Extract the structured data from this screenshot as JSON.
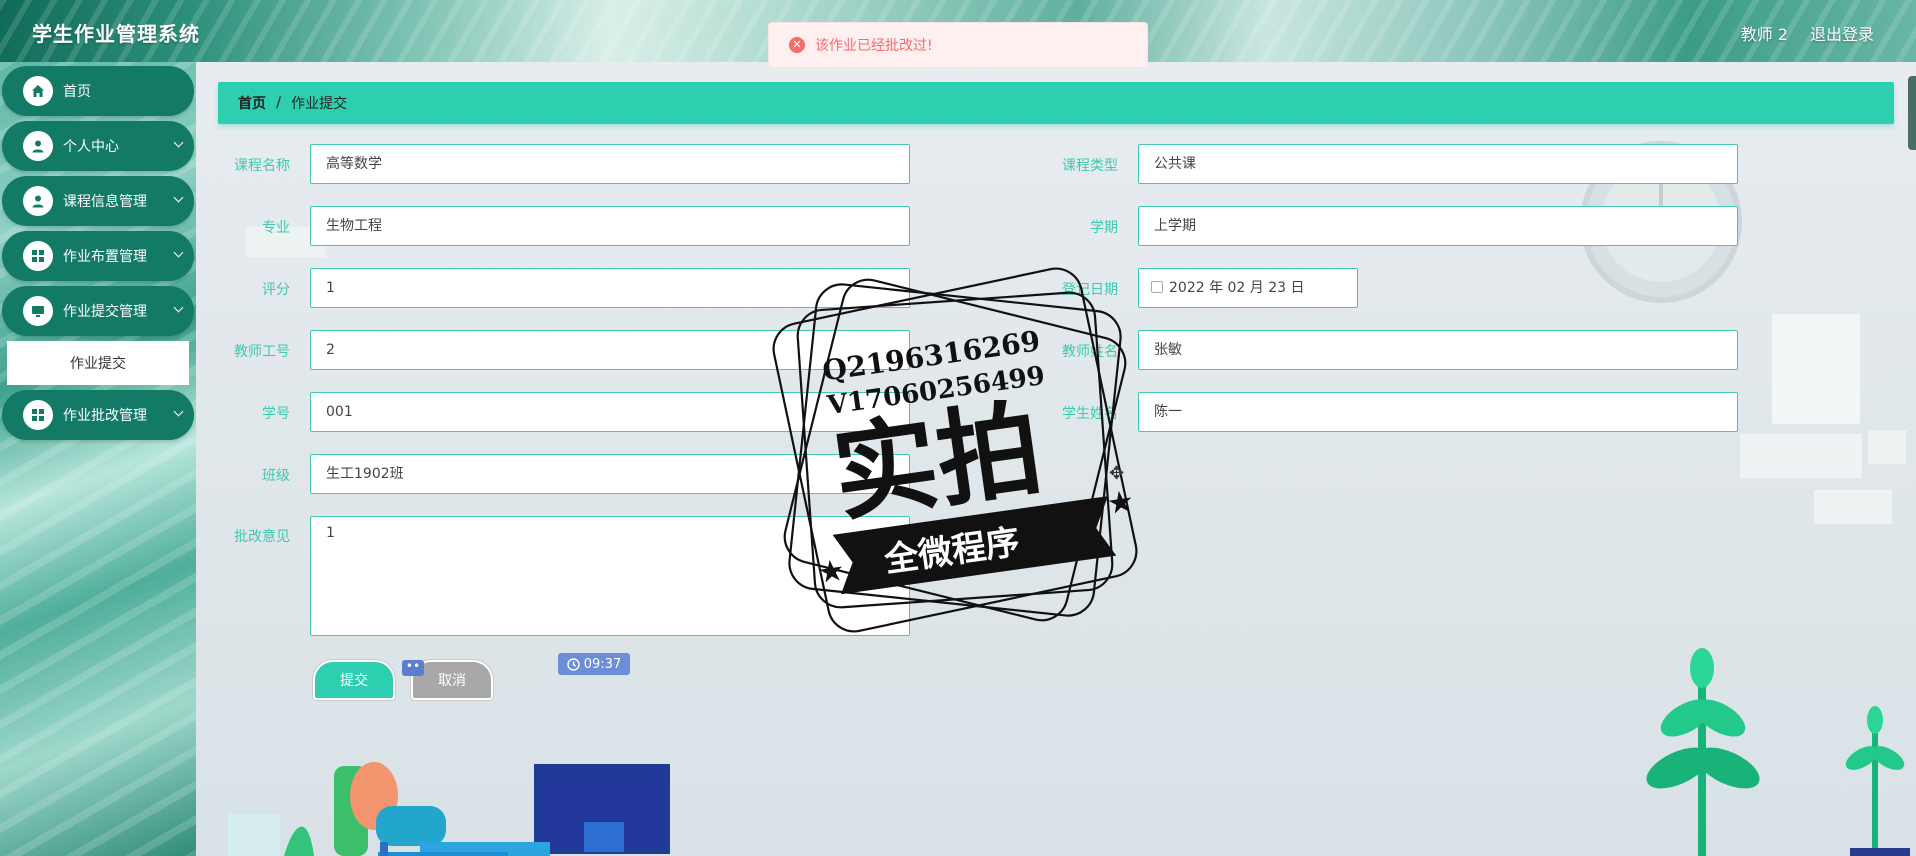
{
  "app": {
    "title": "学生作业管理系统",
    "user_label": "教师 2",
    "logout_label": "退出登录"
  },
  "toast": {
    "message": "该作业已经批改过!",
    "icon": "error-circle-icon",
    "color": "#f56c6c"
  },
  "sidebar": {
    "items": [
      {
        "label": "首页",
        "icon": "home-icon",
        "has_chevron": false
      },
      {
        "label": "个人中心",
        "icon": "user-icon",
        "has_chevron": true
      },
      {
        "label": "课程信息管理",
        "icon": "user-icon",
        "has_chevron": true
      },
      {
        "label": "作业布置管理",
        "icon": "grid-icon",
        "has_chevron": true
      },
      {
        "label": "作业提交管理",
        "icon": "monitor-icon",
        "has_chevron": true
      },
      {
        "label": "作业批改管理",
        "icon": "grid-icon",
        "has_chevron": true
      }
    ],
    "submenu": {
      "label": "作业提交"
    }
  },
  "breadcrumb": {
    "home": "首页",
    "separator": "/",
    "current": "作业提交"
  },
  "form": {
    "course_name": {
      "label": "课程名称",
      "value": "高等数学"
    },
    "course_type": {
      "label": "课程类型",
      "value": "公共课"
    },
    "major": {
      "label": "专业",
      "value": "生物工程"
    },
    "semester": {
      "label": "学期",
      "value": "上学期"
    },
    "score": {
      "label": "评分",
      "value": "1"
    },
    "register_date": {
      "label": "登记日期",
      "value": "2022 年 02 月 23 日"
    },
    "teacher_id": {
      "label": "教师工号",
      "value": "2"
    },
    "teacher_name": {
      "label": "教师姓名",
      "value": "张敏"
    },
    "student_id": {
      "label": "学号",
      "value": "001"
    },
    "student_name": {
      "label": "学生姓名",
      "value": "陈一"
    },
    "class": {
      "label": "班级",
      "value": "生工1902班"
    },
    "comment": {
      "label": "批改意见",
      "value": "1"
    },
    "submit_label": "提交",
    "cancel_label": "取消"
  },
  "overlay": {
    "clock": "09:37",
    "stamp_line1": "Q2196316269",
    "stamp_line2": "V17060256499",
    "stamp_main": "实拍",
    "stamp_banner": "全微程序"
  },
  "colors": {
    "accent": "#2ecfb0",
    "sidebar_item": "#137a66",
    "label": "#3ecab1"
  }
}
